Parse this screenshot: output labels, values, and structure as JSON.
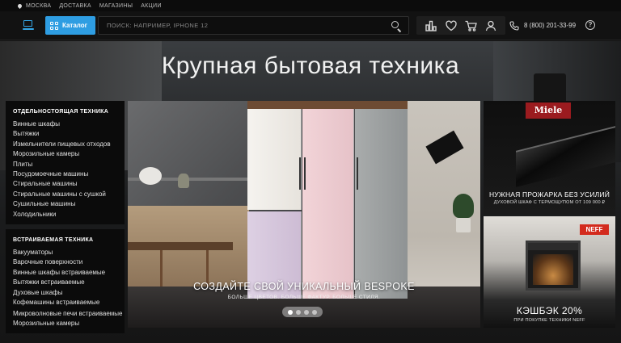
{
  "topbar": {
    "city": "МОСКВА",
    "links": [
      "ДОСТАВКА",
      "МАГАЗИНЫ",
      "АКЦИИ"
    ]
  },
  "header": {
    "catalog_label": "Каталог",
    "search_placeholder": "ПОИСК: НАПРИМЕР, IPHONE 12",
    "icons": [
      "compare-icon",
      "heart-icon",
      "cart-icon",
      "user-icon"
    ],
    "phone": "8 (800) 201-33-99",
    "help": "?"
  },
  "colors": {
    "accent": "#2e9de2",
    "logo": "#34a7e8",
    "miele": "#9b1b1f",
    "neff": "#d32a1d"
  },
  "page_title": "Крупная бытовая техника",
  "sidebar": {
    "sections": [
      {
        "title": "ОТДЕЛЬНОСТОЯЩАЯ ТЕХНИКА",
        "items": [
          "Винные шкафы",
          "Вытяжки",
          "Измельчители пищевых отходов",
          "Морозильные камеры",
          "Плиты",
          "Посудомоечные машины",
          "Стиральные машины",
          "Стиральные машины с сушкой",
          "Сушильные машины",
          "Холодильники"
        ]
      },
      {
        "title": "ВСТРАИВАЕМАЯ ТЕХНИКА",
        "items": [
          "Вакууматоры",
          "Варочные поверхности",
          "Винные шкафы встраиваемые",
          "Вытяжки встраиваемые",
          "Духовые шкафы",
          "Кофемашины встраиваемые",
          "Микроволновые печи встраиваемые",
          "Морозильные камеры"
        ]
      }
    ]
  },
  "banner": {
    "title": "СОЗДАЙТЕ СВОЙ УНИКАЛЬНЫЙ BESPOKE",
    "subtitle": "БОЛЬШЕ ЦВЕТОВ. БОЛЬШЕ ФАКТУР. БОЛЬШЕ СТИЛЯ.",
    "slides": 4,
    "active_slide": 1
  },
  "promos": [
    {
      "brand": "Miele",
      "title": "НУЖНАЯ ПРОЖАРКА БЕЗ УСИЛИЙ",
      "subtitle": "ДУХОВОЙ ШКАФ С ТЕРМОЩУПОМ ОТ 109 000 ₽"
    },
    {
      "brand": "NEFF",
      "title": "КЭШБЭК 20%",
      "subtitle": "ПРИ ПОКУПКЕ ТЕХНИКИ NEFF"
    }
  ]
}
